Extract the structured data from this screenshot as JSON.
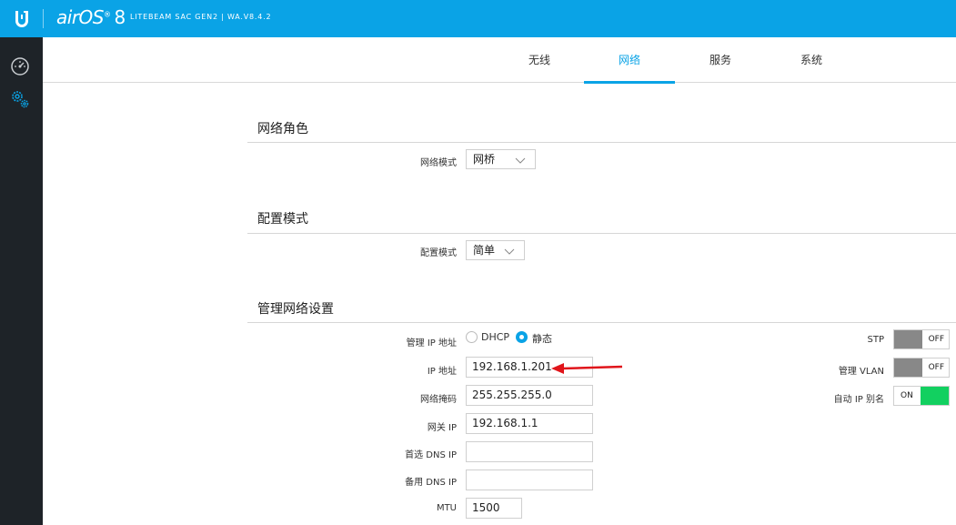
{
  "header": {
    "brand": "air",
    "brand_os": "OS",
    "brand_version": "8",
    "brand_sup": "®",
    "device": "LITEBEAM SAC GEN2 | WA.V8.4.2",
    "color": "#0aa3e6"
  },
  "sidebar": {
    "items": [
      {
        "icon": "dashboard-icon"
      },
      {
        "icon": "settings-gears-icon"
      }
    ]
  },
  "tabs": [
    {
      "label": "无线",
      "active": false
    },
    {
      "label": "网络",
      "active": true
    },
    {
      "label": "服务",
      "active": false
    },
    {
      "label": "系统",
      "active": false
    }
  ],
  "network_role": {
    "title": "网络角色",
    "mode_label": "网络模式",
    "mode_value": "网桥"
  },
  "config_mode": {
    "title": "配置模式",
    "mode_label": "配置模式",
    "mode_value": "简单"
  },
  "mgmt": {
    "title": "管理网络设置",
    "ip_addr_label": "管理 IP 地址",
    "radio_dhcp": "DHCP",
    "radio_static": "静态",
    "selected": "静态",
    "ip_label": "IP 地址",
    "ip_value": "192.168.1.201",
    "mask_label": "网络掩码",
    "mask_value": "255.255.255.0",
    "gw_label": "网关 IP",
    "gw_value": "192.168.1.1",
    "dns1_label": "首选 DNS IP",
    "dns1_value": "",
    "dns2_label": "备用 DNS IP",
    "dns2_value": "",
    "mtu_label": "MTU",
    "mtu_value": "1500",
    "stp_label": "STP",
    "stp_state": "OFF",
    "vlan_label": "管理 VLAN",
    "vlan_state": "OFF",
    "alias_label": "自动 IP 别名",
    "alias_state": "ON"
  },
  "annotation": {
    "arrow_color": "#e0151b"
  }
}
